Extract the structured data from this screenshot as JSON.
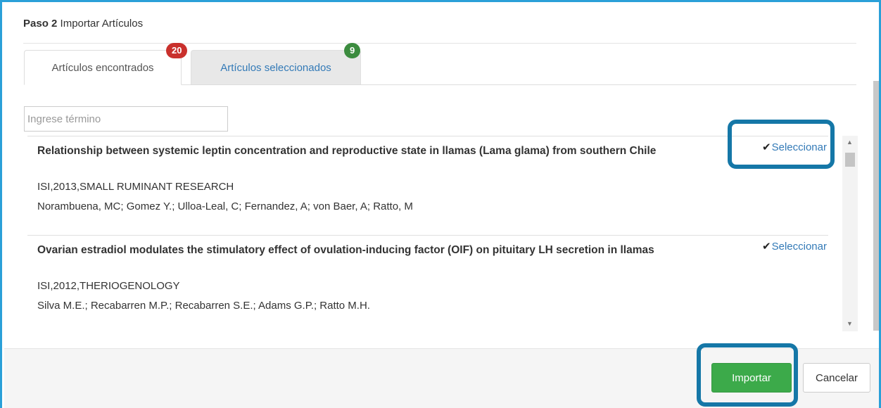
{
  "step": {
    "label": "Paso 2",
    "title": "Importar Artículos"
  },
  "tabs": [
    {
      "label": "Artículos encontrados",
      "badge": "20",
      "badge_color": "#c9302c",
      "active": true
    },
    {
      "label": "Artículos seleccionados",
      "badge": "9",
      "badge_color": "#3c8c3f",
      "active": false
    }
  ],
  "search": {
    "placeholder": "Ingrese término",
    "value": ""
  },
  "articles": [
    {
      "title": "Relationship between systemic leptin concentration and reproductive state in llamas (Lama glama) from southern Chile",
      "source": "ISI,2013,SMALL RUMINANT RESEARCH",
      "authors": "Norambuena, MC; Gomez Y.; Ulloa-Leal, C; Fernandez, A; von Baer, A; Ratto, M",
      "select_label": "Seleccionar",
      "check_icon": "checkmark-icon"
    },
    {
      "title": "Ovarian estradiol modulates the stimulatory effect of ovulation-inducing factor (OIF) on pituitary LH secretion in llamas",
      "source": "ISI,2012,THERIOGENOLOGY",
      "authors": "Silva M.E.; Recabarren M.P.; Recabarren S.E.; Adams G.P.; Ratto M.H.",
      "select_label": "Seleccionar",
      "check_icon": "checkmark-icon"
    }
  ],
  "footer": {
    "import_label": "Importar",
    "cancel_label": "Cancelar"
  },
  "colors": {
    "frame": "#2aa0d8",
    "highlight": "#1577a7",
    "import_button": "#3caa4a",
    "link": "#337ab7"
  }
}
